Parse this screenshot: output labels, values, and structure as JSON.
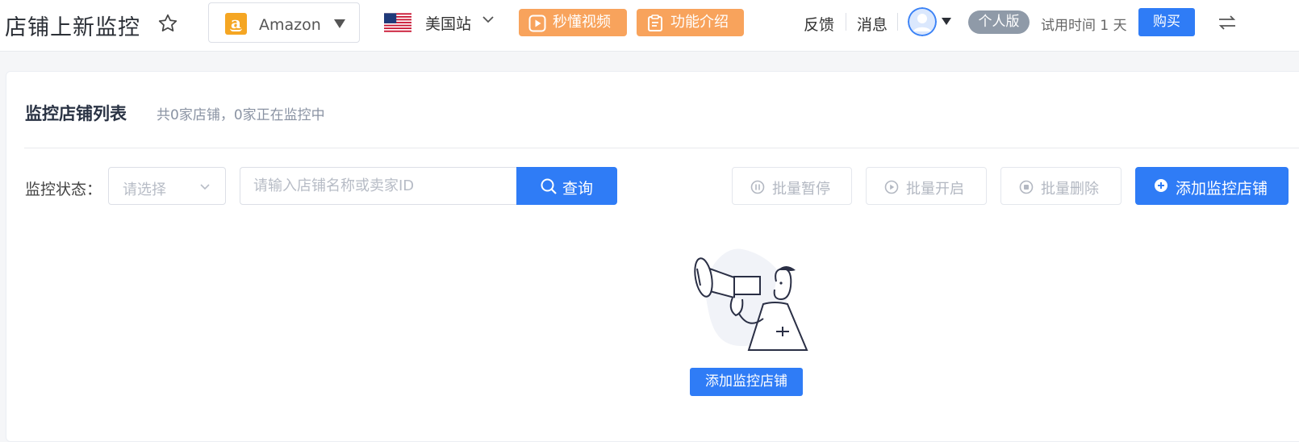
{
  "header": {
    "title": "店铺上新监控",
    "platform": {
      "logo_letter": "a",
      "label": "Amazon"
    },
    "site": {
      "label": "美国站"
    },
    "video_button": "秒懂视频",
    "intro_button": "功能介绍",
    "feedback": "反馈",
    "messages": "消息",
    "edition_badge": "个人版",
    "trial_text": "试用时间 1 天",
    "buy_button": "购买"
  },
  "main": {
    "list_title": "监控店铺列表",
    "summary": "共0家店铺，0家正在监控中",
    "filter": {
      "status_label": "监控状态：",
      "status_placeholder": "请选择",
      "search_placeholder": "请输入店铺名称或卖家ID",
      "search_value": "",
      "query_button": "查询"
    },
    "batch": {
      "pause": "批量暂停",
      "start": "批量开启",
      "delete": "批量删除"
    },
    "add_button": "添加监控店铺",
    "empty": {
      "add_button": "添加监控店铺"
    }
  },
  "colors": {
    "primary": "#2f7cf6",
    "orange": "#f8a35c",
    "badge_gray": "#8f9aa8",
    "amazon": "#f5a623"
  },
  "icons": {
    "star": "star-icon",
    "play": "play-icon",
    "clipboard": "clipboard-icon",
    "avatar": "user-avatar-icon",
    "switch": "switch-icon",
    "search": "search-icon",
    "pause": "pause-circle-icon",
    "start": "play-circle-icon",
    "delete": "stop-circle-icon",
    "add": "plus-circle-icon",
    "empty": "megaphone-illustration"
  }
}
